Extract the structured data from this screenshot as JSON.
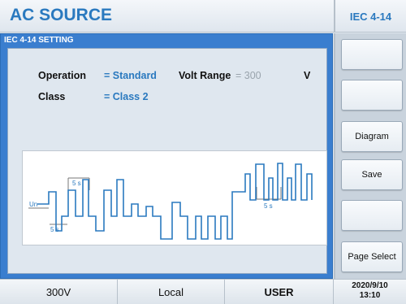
{
  "header": {
    "app_title": "AC SOURCE",
    "mode_title": "IEC 4-14"
  },
  "panel": {
    "title": "IEC 4-14 SETTING",
    "operation_label": "Operation",
    "operation_value": "= Standard",
    "volt_range_label": "Volt Range",
    "volt_range_value": "= 300",
    "volt_unit": "V",
    "class_label": "Class",
    "class_value": "= Class 2"
  },
  "diagram": {
    "un_label": "Un",
    "time_label_1": "5 s",
    "time_label_2": "5 s",
    "time_label_3": "5 s",
    "waveform_color": "#2a79bf"
  },
  "softkeys": [
    "",
    "",
    "Diagram",
    "Save",
    "",
    "Page Select"
  ],
  "status": {
    "range": "300V",
    "control": "Local",
    "user": "USER",
    "date": "2020/9/10",
    "time": "13:10"
  }
}
